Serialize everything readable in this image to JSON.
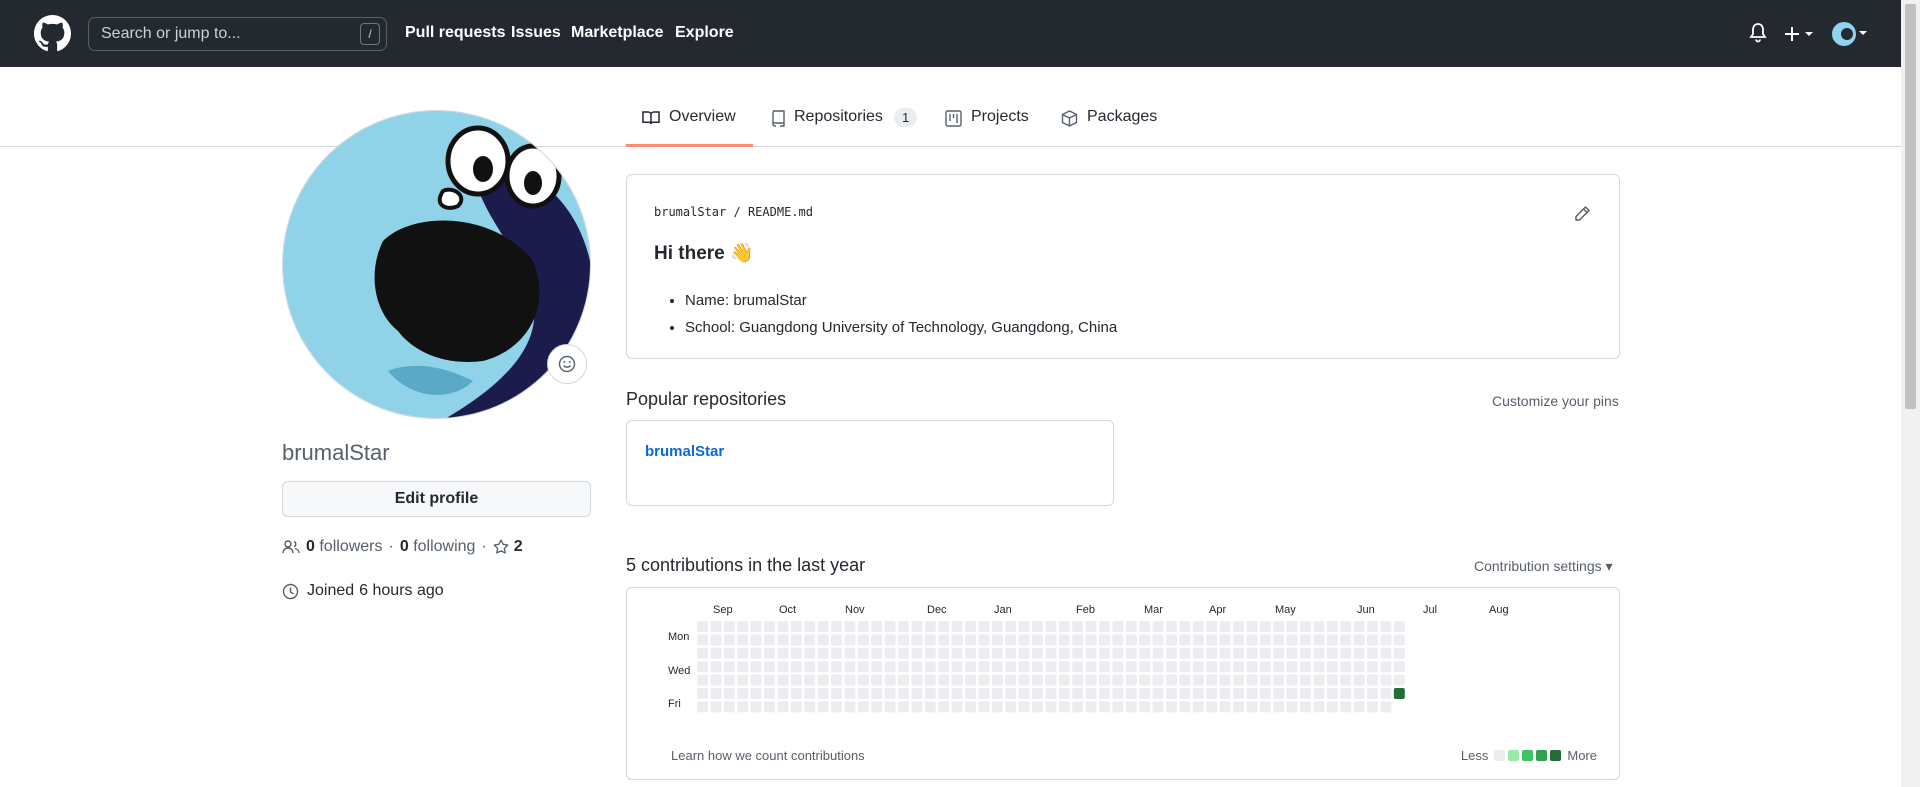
{
  "header": {
    "search_placeholder": "Search or jump to...",
    "search_shortcut": "/",
    "nav": [
      "Pull requests",
      "Issues",
      "Marketplace",
      "Explore"
    ]
  },
  "tabs": [
    {
      "label": "Overview",
      "icon": "book-icon",
      "active": true
    },
    {
      "label": "Repositories",
      "icon": "repo-icon",
      "count": "1"
    },
    {
      "label": "Projects",
      "icon": "project-icon"
    },
    {
      "label": "Packages",
      "icon": "package-icon"
    }
  ],
  "profile": {
    "username": "brumalStar",
    "edit_label": "Edit profile",
    "followers_count": "0",
    "followers_label": "followers",
    "following_count": "0",
    "following_label": "following",
    "stars_count": "2",
    "joined_prefix": "Joined",
    "joined_time": "6 hours ago"
  },
  "readme": {
    "owner": "brumalStar",
    "sep": "/",
    "file": "README.md",
    "heading": "Hi there 👋",
    "items": [
      "Name: brumalStar",
      "School: Guangdong University of Technology, Guangdong, China"
    ]
  },
  "popular": {
    "title": "Popular repositories",
    "customize": "Customize your pins",
    "repos": [
      "brumalStar"
    ]
  },
  "contributions": {
    "title": "5 contributions in the last year",
    "settings": "Contribution settings ▾",
    "months": [
      "Sep",
      "Oct",
      "Nov",
      "Dec",
      "Jan",
      "Feb",
      "Mar",
      "Apr",
      "May",
      "Jun",
      "Jul",
      "Aug"
    ],
    "days": [
      "Mon",
      "Wed",
      "Fri"
    ],
    "learn": "Learn how we count contributions",
    "less": "Less",
    "more": "More",
    "colors": [
      "#ebedf0",
      "#9be9a8",
      "#40c463",
      "#30a14e",
      "#216e39"
    ]
  }
}
